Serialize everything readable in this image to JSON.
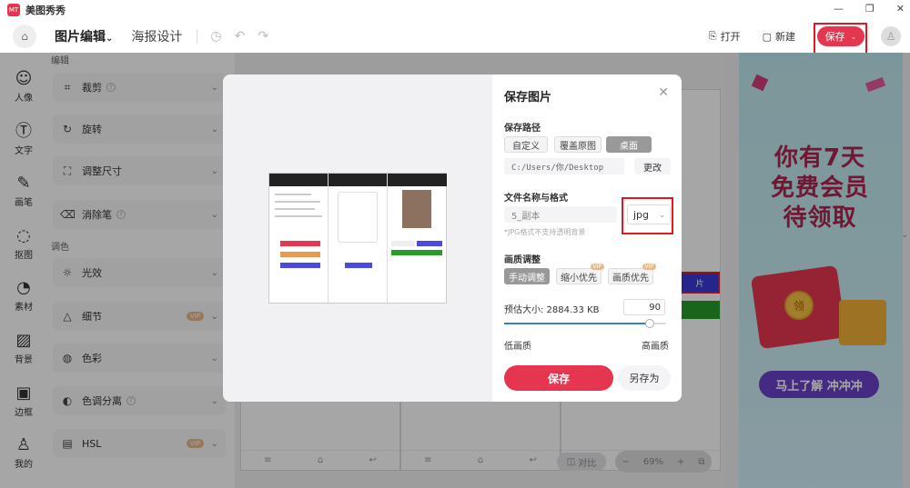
{
  "app": {
    "title": "美图秀秀",
    "logo_text": "MT"
  },
  "window": {
    "minimize": "—",
    "maximize": "❐",
    "close": "✕"
  },
  "toolbar": {
    "home_icon": "home-icon",
    "tab_active": "图片编辑",
    "tab_active_chevron": "⌄",
    "tab_poster": "海报设计",
    "open_label": "打开",
    "new_label": "新建",
    "save_label": "保存",
    "save_chevron": "⌄"
  },
  "rail": [
    {
      "label": "人像",
      "icon": "☺"
    },
    {
      "label": "文字",
      "icon": "Ⓣ"
    },
    {
      "label": "画笔",
      "icon": "✎"
    },
    {
      "label": "抠图",
      "icon": "◌"
    },
    {
      "label": "素材",
      "icon": "◔"
    },
    {
      "label": "背景",
      "icon": "▨"
    },
    {
      "label": "边框",
      "icon": "▣"
    },
    {
      "label": "我的",
      "icon": "♙"
    }
  ],
  "panel": {
    "section_edit": "编辑",
    "section_color": "调色",
    "tools": [
      {
        "label": "裁剪",
        "icon": "⌗",
        "help": "?"
      },
      {
        "label": "旋转",
        "icon": "↻"
      },
      {
        "label": "调整尺寸",
        "icon": "⛶"
      },
      {
        "label": "消除笔",
        "icon": "⌫",
        "help": "?"
      },
      {
        "label": "光效",
        "icon": "☼"
      },
      {
        "label": "细节",
        "icon": "△",
        "vip": "VIP"
      },
      {
        "label": "色彩",
        "icon": "◍"
      },
      {
        "label": "色调分离",
        "icon": "◐",
        "help": "?"
      },
      {
        "label": "HSL",
        "icon": "▤",
        "vip": "VIP"
      }
    ]
  },
  "canvas": {
    "compare_label": "对比",
    "zoom_value": "69%",
    "zoom_minus": "−",
    "zoom_plus": "+",
    "right_button_text": "片"
  },
  "ad": {
    "title_line1": "你有7天",
    "title_line2": "免费会员",
    "title_line3": "待领取",
    "coin_text": "领",
    "cta": "马上了解 冲冲冲"
  },
  "modal": {
    "title": "保存图片",
    "close": "✕",
    "path_section": "保存路径",
    "path_options": [
      "自定义",
      "覆盖原图",
      "桌面"
    ],
    "path_selected": "桌面",
    "path_value": "C:/Users/你/Desktop",
    "change_label": "更改",
    "name_section": "文件名称与格式",
    "file_name": "5_副本",
    "format": "jpg",
    "format_hint": "*JPG格式不支持透明背景",
    "quality_section": "画质调整",
    "quality_options": [
      {
        "label": "手动调整"
      },
      {
        "label": "缩小优先",
        "vip": "VIP"
      },
      {
        "label": "画质优先",
        "vip": "VIP"
      }
    ],
    "quality_selected": "手动调整",
    "est_size_label": "预估大小: 2884.33 KB",
    "quality_value": "90",
    "quality_fraction": 0.9,
    "low_label": "低画质",
    "high_label": "高画质",
    "save_label": "保存",
    "save_as_label": "另存为"
  },
  "colors": {
    "accent": "#e6364f",
    "highlight": "#e8161f",
    "ad_cta": "#6b41c9",
    "slider": "#3a7bd5"
  }
}
